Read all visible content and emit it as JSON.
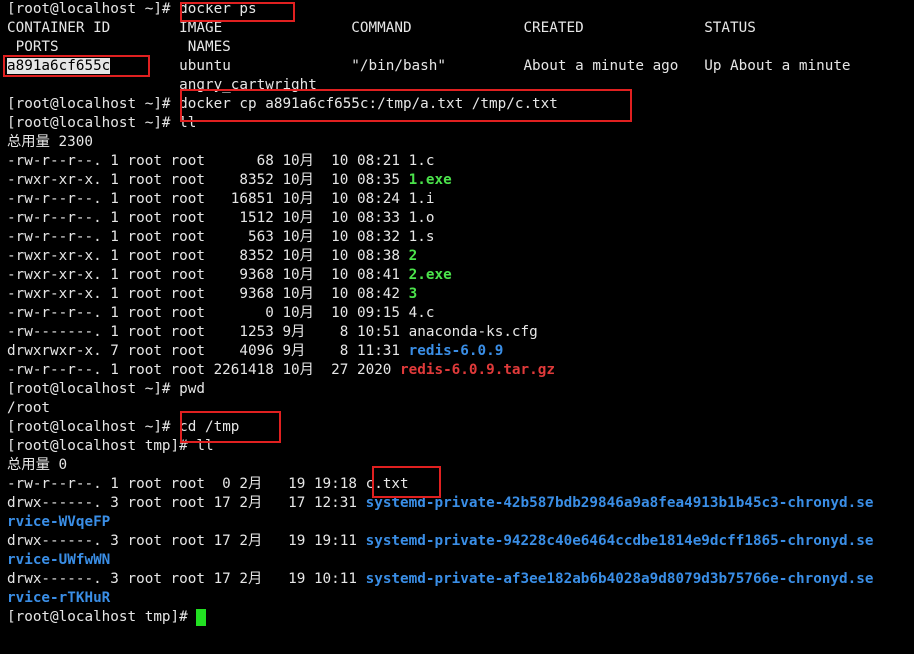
{
  "prompt_root_home": "[root@localhost ~]# ",
  "prompt_root_tmp": "[root@localhost tmp]# ",
  "docker_ps": {
    "command": "docker ps",
    "header_line1": "CONTAINER ID        IMAGE               COMMAND             CREATED              STATUS",
    "header_line2": " PORTS               NAMES",
    "container_id": "a891a6cf655c",
    "row_rest": "        ubuntu              \"/bin/bash\"         About a minute ago   Up About a minute",
    "row_name": "                    angry_cartwright"
  },
  "docker_cp_command": "docker cp a891a6cf655c:/tmp/a.txt /tmp/c.txt",
  "ll_command": "ll",
  "home_listing": {
    "total": "总用量 2300",
    "files": [
      {
        "meta": "-rw-r--r--. 1 root root      68 10月  10 08:21 ",
        "name": "1.c",
        "type": "plain"
      },
      {
        "meta": "-rwxr-xr-x. 1 root root    8352 10月  10 08:35 ",
        "name": "1.exe",
        "type": "exe"
      },
      {
        "meta": "-rw-r--r--. 1 root root   16851 10月  10 08:24 ",
        "name": "1.i",
        "type": "plain"
      },
      {
        "meta": "-rw-r--r--. 1 root root    1512 10月  10 08:33 ",
        "name": "1.o",
        "type": "plain"
      },
      {
        "meta": "-rw-r--r--. 1 root root     563 10月  10 08:32 ",
        "name": "1.s",
        "type": "plain"
      },
      {
        "meta": "-rwxr-xr-x. 1 root root    8352 10月  10 08:38 ",
        "name": "2",
        "type": "exe"
      },
      {
        "meta": "-rwxr-xr-x. 1 root root    9368 10月  10 08:41 ",
        "name": "2.exe",
        "type": "exe"
      },
      {
        "meta": "-rwxr-xr-x. 1 root root    9368 10月  10 08:42 ",
        "name": "3",
        "type": "exe"
      },
      {
        "meta": "-rw-r--r--. 1 root root       0 10月  10 09:15 ",
        "name": "4.c",
        "type": "plain"
      },
      {
        "meta": "-rw-------. 1 root root    1253 9月    8 10:51 ",
        "name": "anaconda-ks.cfg",
        "type": "plain"
      },
      {
        "meta": "drwxrwxr-x. 7 root root    4096 9月    8 11:31 ",
        "name": "redis-6.0.9",
        "type": "dir"
      },
      {
        "meta": "-rw-r--r--. 1 root root 2261418 10月  27 2020 ",
        "name": "redis-6.0.9.tar.gz",
        "type": "arc"
      }
    ]
  },
  "pwd_command": "pwd",
  "pwd_output": "/root",
  "cd_command": "cd /tmp",
  "tmp_listing": {
    "total": "总用量 0",
    "ctxt_meta": "-rw-r--r--. 1 root root  0 2月   19 19:18 ",
    "ctxt_name": "c.txt",
    "dirs": [
      {
        "meta": "drwx------. 3 root root 17 2月   17 12:31 ",
        "name1": "systemd-private-42b587bdb29846a9a8fea4913b1b45c3-chronyd.se",
        "name2": "rvice-WVqeFP"
      },
      {
        "meta": "drwx------. 3 root root 17 2月   19 19:11 ",
        "name1": "systemd-private-94228c40e6464ccdbe1814e9dcff1865-chronyd.se",
        "name2": "rvice-UWfwWN"
      },
      {
        "meta": "drwx------. 3 root root 17 2月   19 10:11 ",
        "name1": "systemd-private-af3ee182ab6b4028a9d8079d3b75766e-chronyd.se",
        "name2": "rvice-rTKHuR"
      }
    ]
  },
  "colors": {
    "background": "#000000",
    "text": "#e6e6e6",
    "executable": "#4be34b",
    "directory": "#3a8ee6",
    "archive": "#e03a3a",
    "highlight_box": "#e02020",
    "cursor": "#22e022"
  }
}
